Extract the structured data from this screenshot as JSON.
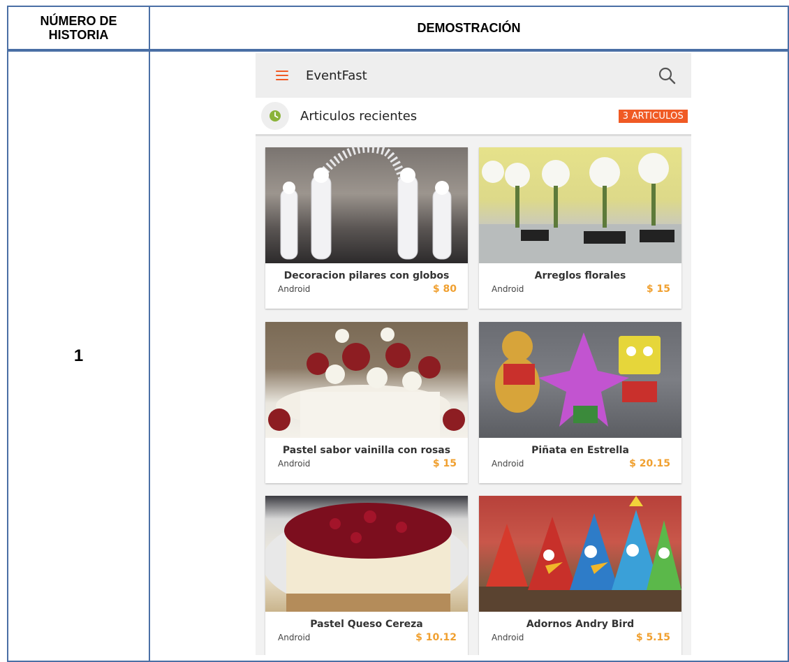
{
  "doc": {
    "header_num": "NÚMERO DE HISTORIA",
    "header_num_line1": "NÚMERO DE",
    "header_num_line2": "HISTORIA",
    "header_demo": "DEMOSTRACIÓN",
    "story_number": "1"
  },
  "app": {
    "title": "EventFast",
    "section_title": "Articulos recientes",
    "badge": "3 ARTICULOS",
    "colors": {
      "accent": "#f05a24",
      "price": "#f0a030",
      "clock": "#8bb33a"
    },
    "items": [
      {
        "title": "Decoracion pilares con globos",
        "platform": "Android",
        "price": "$ 80"
      },
      {
        "title": "Arreglos florales",
        "platform": "Android",
        "price": "$ 15"
      },
      {
        "title": "Pastel sabor vainilla con rosas",
        "platform": "Android",
        "price": "$ 15"
      },
      {
        "title": "Piñata en Estrella",
        "platform": "Android",
        "price": "$ 20.15"
      },
      {
        "title": "Pastel Queso Cereza",
        "platform": "Android",
        "price": "$ 10.12"
      },
      {
        "title": "Adornos Andry Bird",
        "platform": "Android",
        "price": "$ 5.15"
      }
    ]
  }
}
